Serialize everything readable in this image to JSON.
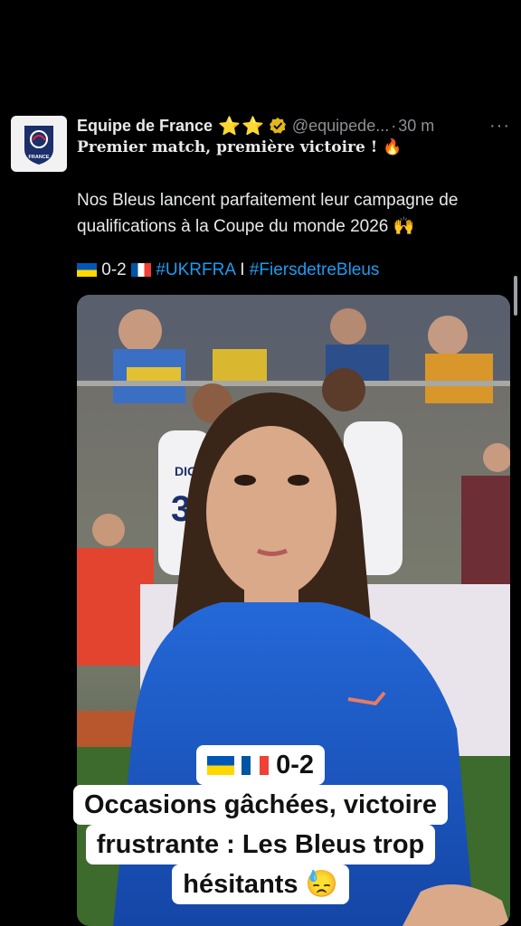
{
  "tweet": {
    "author": "Equipe de France",
    "stars": "⭐⭐",
    "handle": "@equipede...",
    "separator": "·",
    "time": "30 m",
    "more": "···",
    "headline": "Premier match, première victoire ! 🔥",
    "body_line1": "Nos Bleus lancent parfaitement leur campagne de",
    "body_line2": "qualifications à la Coupe du monde 2026 🙌",
    "score": "0-2",
    "hashtag1": "#UKRFRA",
    "divider": "I",
    "hashtag2": "#FiersdetreBleus",
    "avatar_text": "FRANCE",
    "jersey_name": "DIGNE",
    "jersey_number": "3"
  },
  "captions": {
    "score": "0-2",
    "line1": "Occasions gâchées, victoire",
    "line2": "frustrante : Les Bleus trop",
    "line3": "hésitants 😓"
  },
  "colors": {
    "background": "#000000",
    "link": "#1d9bf0",
    "muted": "#8b8f94",
    "star": "#f7c325",
    "shirt_blue": "#1f5fc9"
  }
}
